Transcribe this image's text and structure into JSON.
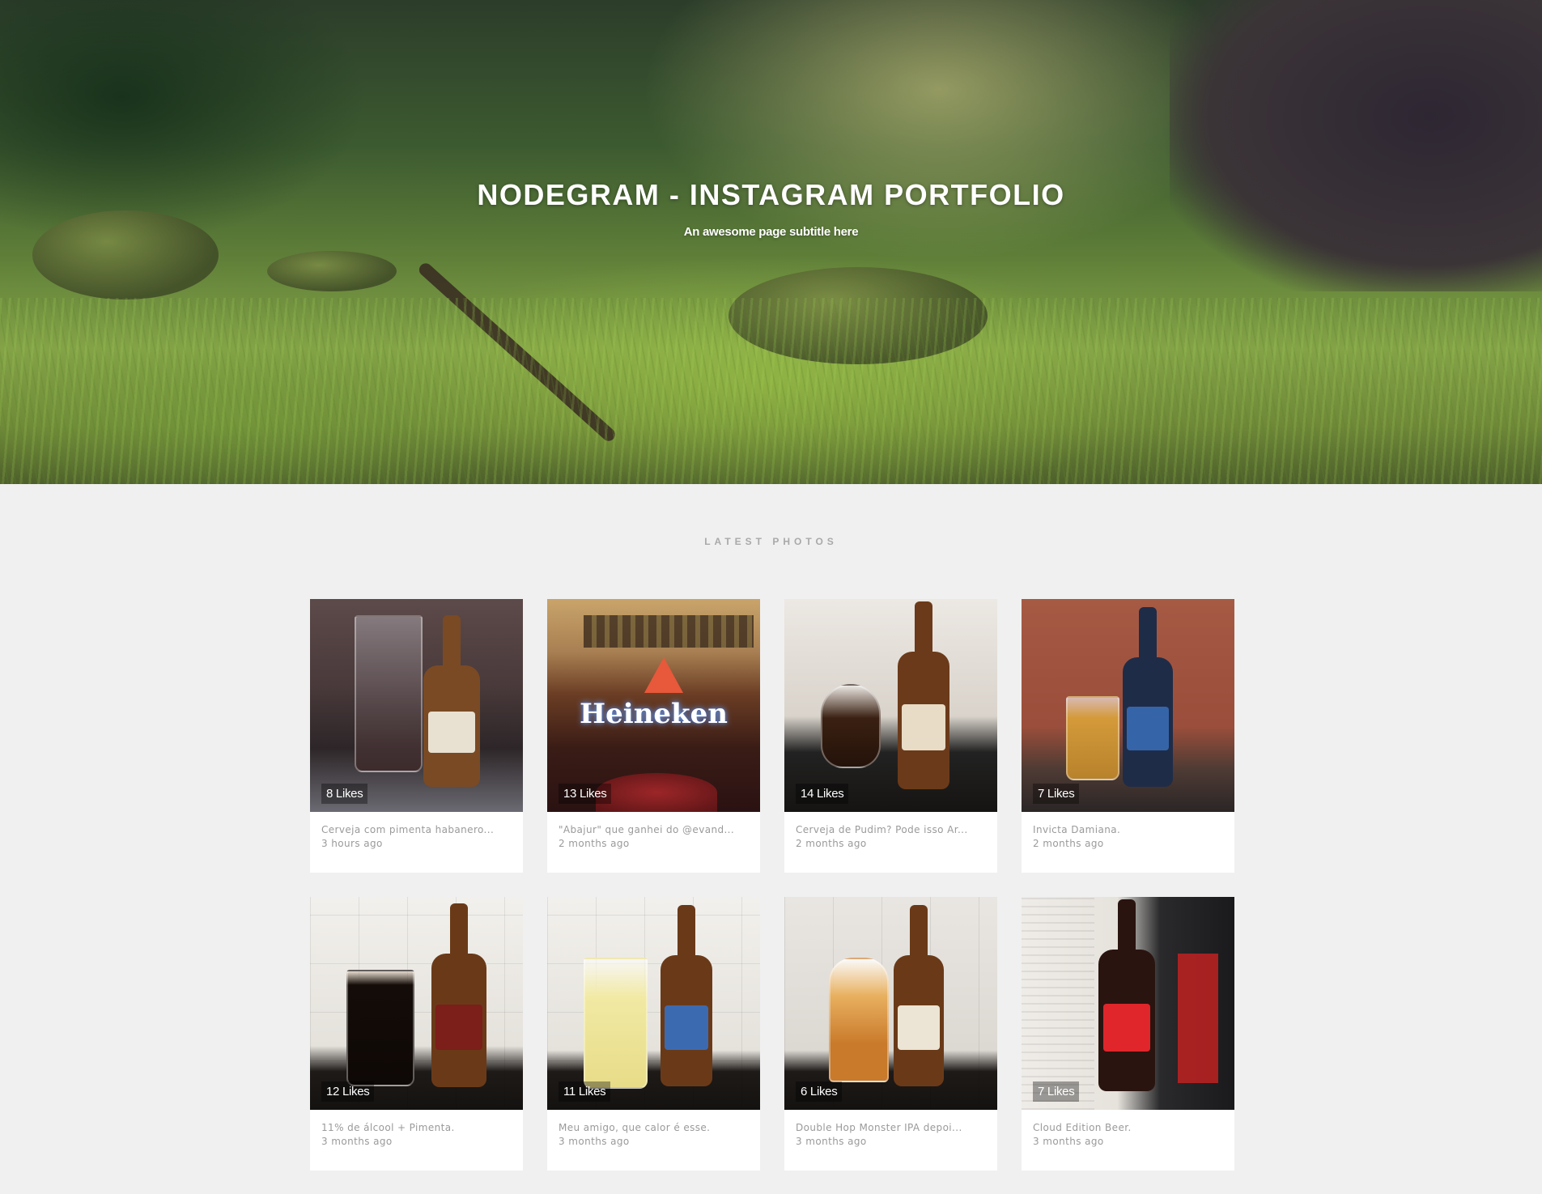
{
  "hero": {
    "title": "NODEGRAM - INSTAGRAM PORTFOLIO",
    "subtitle": "An awesome page subtitle here"
  },
  "section": {
    "heading": "LATEST PHOTOS"
  },
  "photos": [
    {
      "likes": "8 Likes",
      "caption": "Cerveja com pimenta habanero...",
      "time": "3 hours ago"
    },
    {
      "likes": "13 Likes",
      "caption": "\"Abajur\" que ganhei do @evand...",
      "time": "2 months ago",
      "sign_text": "Heineken"
    },
    {
      "likes": "14 Likes",
      "caption": "Cerveja de Pudim? Pode isso Ar...",
      "time": "2 months ago"
    },
    {
      "likes": "7 Likes",
      "caption": "Invicta Damiana.",
      "time": "2 months ago"
    },
    {
      "likes": "12 Likes",
      "caption": "11% de álcool + Pimenta.",
      "time": "3 months ago"
    },
    {
      "likes": "11 Likes",
      "caption": "Meu amigo, que calor é esse.",
      "time": "3 months ago"
    },
    {
      "likes": "6 Likes",
      "caption": "Double Hop Monster IPA depoi...",
      "time": "3 months ago"
    },
    {
      "likes": "7 Likes",
      "caption": "Cloud Edition Beer.",
      "time": "3 months ago"
    }
  ]
}
